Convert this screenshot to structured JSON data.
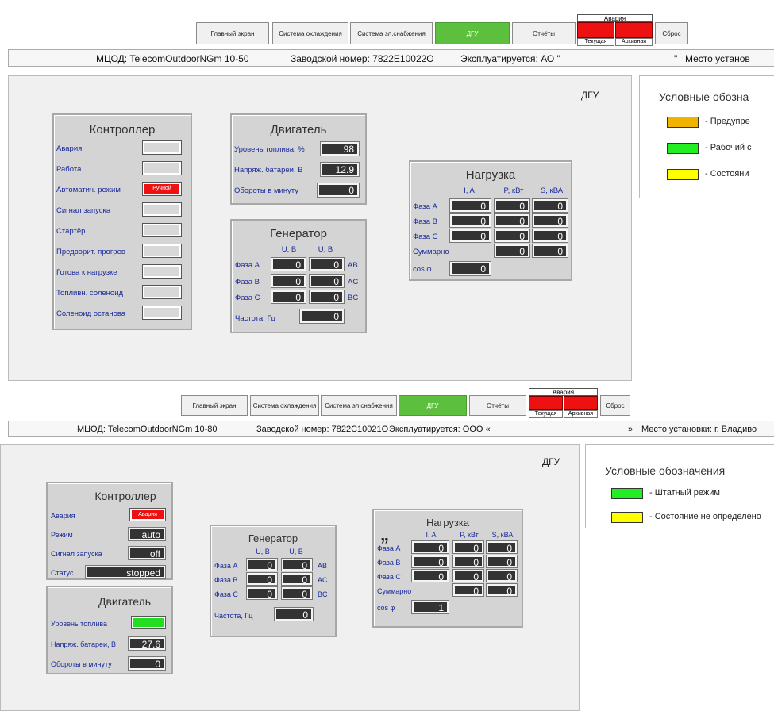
{
  "top": {
    "nav": {
      "main_screen": "Главный экран",
      "cooling": "Система охлаждения",
      "power": "Система эл.снабжения",
      "dgu": "ДГУ",
      "reports": "Отчёты"
    },
    "alarm": {
      "title": "Авария",
      "current": "Текущая",
      "archive": "Архивная"
    },
    "reset": "Сброс",
    "info": {
      "mcod": "МЦОД: TelecomOutdoorNGm 10-50",
      "serial": "Заводской номер: 7822E10022O",
      "operated": "Эксплуатируется: АО \"",
      "quote_end": "\"",
      "location": "Место установ"
    },
    "panel_title": "ДГУ",
    "controller": {
      "title": "Контроллер",
      "rows": [
        "Авария",
        "Работа",
        "Автоматич. режим",
        "Сигнал запуска",
        "Стартёр",
        "Предворит. прогрев",
        "Готова к нагрузке",
        "Топливн. соленоид",
        "Соленоид останова"
      ],
      "auto_mode_value": "Ручной"
    },
    "engine": {
      "title": "Двигатель",
      "fuel_label": "Уровень топлива, %",
      "fuel": "98",
      "battery_label": "Напряж. батареи, В",
      "battery": "12.9",
      "rpm_label": "Обороты в минуту",
      "rpm": "0"
    },
    "generator": {
      "title": "Генератор",
      "col1": "U, В",
      "col2": "U, В",
      "phases": [
        "Фаза A",
        "Фаза B",
        "Фаза C"
      ],
      "u1": [
        "0",
        "0",
        "0"
      ],
      "u2": [
        "0",
        "0",
        "0"
      ],
      "pairs": [
        "AB",
        "AC",
        "BC"
      ],
      "freq_label": "Частота, Гц",
      "freq": "0"
    },
    "load": {
      "title": "Нагрузка",
      "cols": [
        "I, A",
        "P, кВт",
        "S, кВА"
      ],
      "phases": [
        "Фаза A",
        "Фаза B",
        "Фаза C"
      ],
      "i": [
        "0",
        "0",
        "0"
      ],
      "p": [
        "0",
        "0",
        "0"
      ],
      "s": [
        "0",
        "0",
        "0"
      ],
      "total_label": "Суммарно",
      "total_p": "0",
      "total_s": "0",
      "cos_label": "cos φ",
      "cos": "0"
    },
    "legend": {
      "title": "Условные обозна",
      "items": [
        {
          "color": "#f0b400",
          "text": "- Предупре"
        },
        {
          "color": "#22ee22",
          "text": "- Рабочий с"
        },
        {
          "color": "#ffff00",
          "text": "- Состояни"
        }
      ]
    }
  },
  "bottom": {
    "nav": {
      "main_screen": "Главный экран",
      "cooling": "Система охлаждения",
      "power": "Система эл.снабжения",
      "dgu": "ДГУ",
      "reports": "Отчёты"
    },
    "alarm": {
      "title": "Авария",
      "current": "Текущая",
      "archive": "Архивная"
    },
    "reset": "Сброс",
    "info": {
      "mcod": "МЦОД: TelecomOutdoorNGm 10-80",
      "serial": "Заводской номер: 7822C10021O",
      "operated": "Эксплуатируется: ООО «",
      "quote_end": "»",
      "location": "Место установки: г. Владиво"
    },
    "panel_title": "ДГУ",
    "controller": {
      "title": "Контроллер",
      "alarm_label": "Авария",
      "alarm_value": "Авария",
      "mode_label": "Режим",
      "mode": "auto",
      "start_label": "Сигнал запуска",
      "start": "off",
      "status_label": "Статус",
      "status": "stopped"
    },
    "engine": {
      "title": "Двигатель",
      "fuel_label": "Уровень топлива",
      "battery_label": "Напряж. батареи, В",
      "battery": "27.6",
      "rpm_label": "Обороты в минуту",
      "rpm": "0"
    },
    "generator": {
      "title": "Генератор",
      "col1": "U, В",
      "col2": "U, В",
      "phases": [
        "Фаза A",
        "Фаза B",
        "Фаза C"
      ],
      "u1": [
        "0",
        "0",
        "0"
      ],
      "u2": [
        "0",
        "0",
        "0"
      ],
      "pairs": [
        "AB",
        "AC",
        "BC"
      ],
      "freq_label": "Частота, Гц",
      "freq": "0"
    },
    "load": {
      "title": "Нагрузка",
      "cols": [
        "I, A",
        "P, кВт",
        "S, кВА"
      ],
      "phases": [
        "Фаза A",
        "Фаза B",
        "Фаза C"
      ],
      "i": [
        "0",
        "0",
        "0"
      ],
      "p": [
        "0",
        "0",
        "0"
      ],
      "s": [
        "0",
        "0",
        "0"
      ],
      "total_label": "Суммарно",
      "total_p": "0",
      "total_s": "0",
      "cos_label": "cos φ",
      "cos": "1",
      "stray_mark": "„"
    },
    "legend": {
      "title": "Условные обозначения",
      "items": [
        {
          "color": "#22ee22",
          "text": "- Штатный режим"
        },
        {
          "color": "#ffff00",
          "text": "- Состояние не определено"
        }
      ]
    }
  }
}
